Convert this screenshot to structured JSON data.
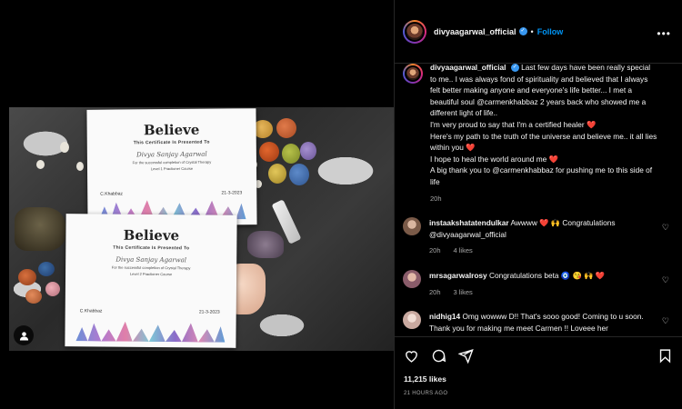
{
  "post": {
    "username": "divyaagarwal_official",
    "follow_label": "Follow",
    "separator": "•",
    "caption_lines": [
      "Last few days have been really special to me.. I was always fond of spirituality and believed that I always felt better making anyone and everyone's life better... I met a beautiful soul @carmenkhabbaz 2 years back who showed me a different light of life..",
      "I'm very proud to say that I'm a certified healer ❤️",
      "Here's my path to the truth of the universe and believe me.. it all lies within you ❤️",
      "I hope to heal the world around me ❤️",
      "A big thank you to @carmenkhabbaz for pushing me to this side of life"
    ],
    "caption_time": "20h",
    "likes": "11,215 likes",
    "posted_ago": "21 HOURS AGO"
  },
  "comments": [
    {
      "username": "instaakshatatendulkar",
      "text": "Awwww ❤️ 🙌 Congratulations @divyaagarwal_official",
      "time": "20h",
      "likes": "4 likes",
      "avatar_color": "#7a5a48"
    },
    {
      "username": "mrsagarwalrosy",
      "text": "Congratulations beta 🧿 😘 🙌 ❤️",
      "time": "20h",
      "likes": "3 likes",
      "avatar_color": "#8a5c6a"
    },
    {
      "username": "nidhig14",
      "text": "Omg wowww D!! That's sooo good! Coming to u soon. Thank you for making me meet Carmen !! Loveee her",
      "time": "",
      "likes": "",
      "avatar_color": "#c9a9a0"
    }
  ],
  "certificates": [
    {
      "title": "Believe",
      "subtitle": "This Certificate Is Presented To",
      "name": "Divya Sanjay Agarwal",
      "line1": "For the successful completion of Crystal Therapy",
      "line2": "Level 1 Practioner Course",
      "signature": "C.Khabbaz",
      "date": "21-3-2023"
    },
    {
      "title": "Believe",
      "subtitle": "This Certificate Is Presented To",
      "name": "Divya Sanjay Agarwal",
      "line1": "For the successful completion of Crystal Therapy",
      "line2": "Level 2 Practioner Course",
      "signature": "C.Khabbaz",
      "date": "21-3-2023"
    }
  ],
  "icons": {
    "verified": "verified-badge-icon",
    "more": "more-options-icon",
    "like": "heart-icon",
    "comment": "comment-icon",
    "share": "share-icon",
    "save": "bookmark-icon",
    "tagged": "tagged-user-icon"
  },
  "colors": {
    "background": "#000000",
    "follow": "#0095f6",
    "verified": "#3897f0",
    "heart": "#ff3040",
    "muted": "#a8a8a8"
  }
}
